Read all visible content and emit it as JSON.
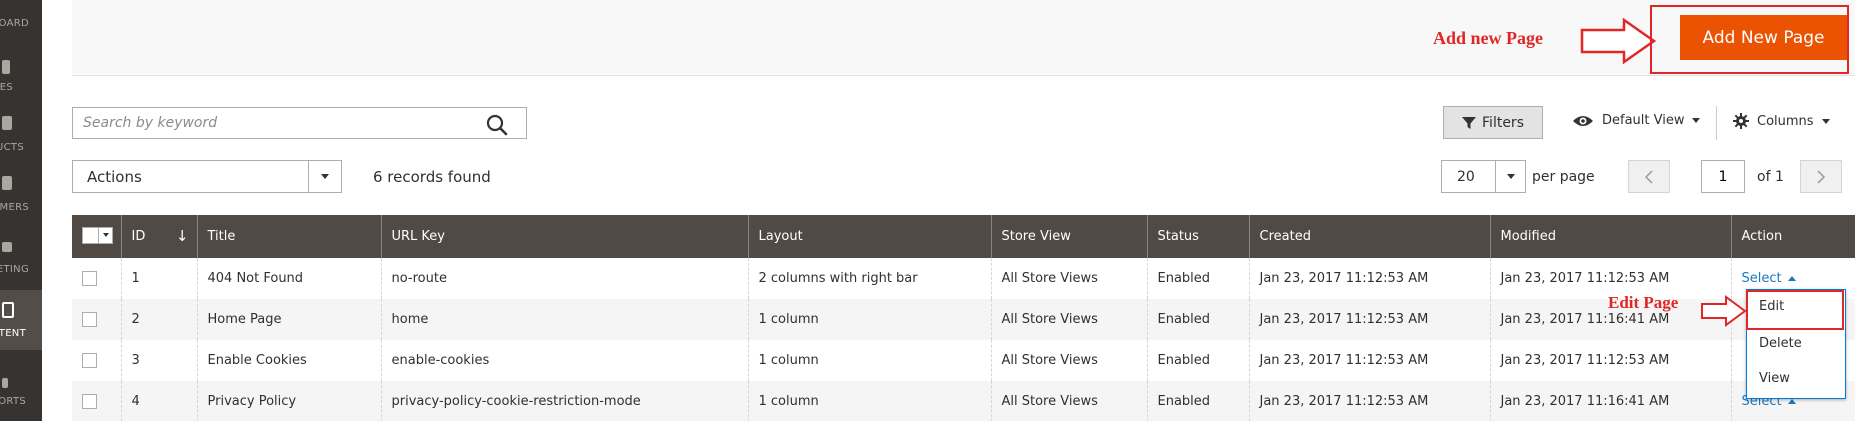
{
  "sidebar": {
    "items": [
      {
        "label": "BOARD"
      },
      {
        "label": "ES"
      },
      {
        "label": "UCTS"
      },
      {
        "label": "MERS"
      },
      {
        "label": "ETING"
      },
      {
        "label": "TENT"
      },
      {
        "label": "ORTS"
      }
    ]
  },
  "header": {
    "add_button_label": "Add New Page",
    "annotation_add": "Add new Page",
    "annotation_edit": "Edit Page",
    "annotation_color": "#e22626",
    "accent": "#eb5202"
  },
  "search": {
    "placeholder": "Search by keyword"
  },
  "toolbar": {
    "filters_label": "Filters",
    "view_label": "Default View",
    "columns_label": "Columns",
    "actions_label": "Actions",
    "records_label": "6 records found",
    "per_page_value": "20",
    "per_page_label": "per page",
    "page_value": "1",
    "page_of": "of 1"
  },
  "table": {
    "columns": [
      "ID",
      "Title",
      "URL Key",
      "Layout",
      "Store View",
      "Status",
      "Created",
      "Modified",
      "Action"
    ],
    "rows": [
      {
        "id": "1",
        "title": "404 Not Found",
        "url_key": "no-route",
        "layout": "2 columns with right bar",
        "store_view": "All Store Views",
        "status": "Enabled",
        "created": "Jan 23, 2017 11:12:53 AM",
        "modified": "Jan 23, 2017 11:12:53 AM",
        "action": "Select"
      },
      {
        "id": "2",
        "title": "Home Page",
        "url_key": "home",
        "layout": "1 column",
        "store_view": "All Store Views",
        "status": "Enabled",
        "created": "Jan 23, 2017 11:12:53 AM",
        "modified": "Jan 23, 2017 11:16:41 AM",
        "action": ""
      },
      {
        "id": "3",
        "title": "Enable Cookies",
        "url_key": "enable-cookies",
        "layout": "1 column",
        "store_view": "All Store Views",
        "status": "Enabled",
        "created": "Jan 23, 2017 11:12:53 AM",
        "modified": "Jan 23, 2017 11:12:53 AM",
        "action": ""
      },
      {
        "id": "4",
        "title": "Privacy Policy",
        "url_key": "privacy-policy-cookie-restriction-mode",
        "layout": "1 column",
        "store_view": "All Store Views",
        "status": "Enabled",
        "created": "Jan 23, 2017 11:12:53 AM",
        "modified": "Jan 23, 2017 11:16:41 AM",
        "action": "Select"
      }
    ]
  },
  "action_menu": {
    "items": [
      "Edit",
      "Delete",
      "View"
    ]
  }
}
